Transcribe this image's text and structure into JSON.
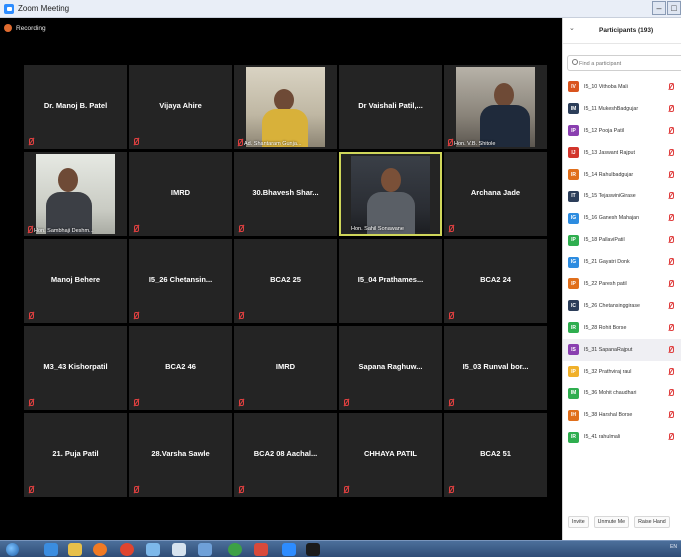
{
  "window": {
    "title": "Zoom Meeting"
  },
  "recording": {
    "label": "Recording"
  },
  "tiles": [
    {
      "name": "Dr. Manoj B. Patel"
    },
    {
      "name": "Vijaya Ahire"
    },
    {
      "name": "",
      "video_label": "Ad. Shantaram Gunja..."
    },
    {
      "name": "Dr Vaishali Patil,..."
    },
    {
      "name": "",
      "video_label": "Hon. V.B. Shitole"
    },
    {
      "name": "",
      "video_label": "Hon. Sambhaji Deshm..."
    },
    {
      "name": "IMRD"
    },
    {
      "name": "30.Bhavesh Shar..."
    },
    {
      "name": "",
      "video_label": "Hon. Sahil Sonawane"
    },
    {
      "name": "Archana Jade"
    },
    {
      "name": "Manoj Behere"
    },
    {
      "name": "I5_26 Chetansin..."
    },
    {
      "name": "BCA2 25"
    },
    {
      "name": "I5_04 Prathames..."
    },
    {
      "name": "BCA2 24"
    },
    {
      "name": "M3_43 Kishorpatil"
    },
    {
      "name": "BCA2 46"
    },
    {
      "name": "IMRD"
    },
    {
      "name": "Sapana Raghuw..."
    },
    {
      "name": "I5_03 Runval bor..."
    },
    {
      "name": "21. Puja Patil"
    },
    {
      "name": "28.Varsha Sawle"
    },
    {
      "name": "BCA2 08 Aachal..."
    },
    {
      "name": "CHHAYA PATIL"
    },
    {
      "name": "BCA2 51"
    }
  ],
  "participants_panel": {
    "title": "Participants (193)",
    "search_placeholder": "Find a participant",
    "items": [
      {
        "initials": "IV",
        "name": "I5_10 Vithoba Mali",
        "color": "#d9541e"
      },
      {
        "initials": "IM",
        "name": "I5_11 MukeshBadgujar",
        "color": "#2c3e5a"
      },
      {
        "initials": "IP",
        "name": "I5_12 Pooja Patil",
        "color": "#8a3fb0"
      },
      {
        "initials": "IJ",
        "name": "I5_13 Jaswant Rajput",
        "color": "#d2352c"
      },
      {
        "initials": "IR",
        "name": "I5_14 Rahulbadgujar",
        "color": "#e06f1c"
      },
      {
        "initials": "IT",
        "name": "I5_15 TejaswiniGirase",
        "color": "#2c3e5a"
      },
      {
        "initials": "IG",
        "name": "I5_16 Ganesh Mahajan",
        "color": "#2d8ce0"
      },
      {
        "initials": "IP",
        "name": "I5_18 PallaviPatil",
        "color": "#2fae4f"
      },
      {
        "initials": "IG",
        "name": "I5_21 Gayatri Donk",
        "color": "#2d8ce0"
      },
      {
        "initials": "IP",
        "name": "I5_22 Paresh patil",
        "color": "#e06f1c"
      },
      {
        "initials": "IC",
        "name": "I5_26 Chetansinggirase",
        "color": "#2c3e5a"
      },
      {
        "initials": "IR",
        "name": "I5_28 Rohit Borse",
        "color": "#2fae4f"
      },
      {
        "initials": "IS",
        "name": "I5_31 SapanaRajput",
        "color": "#8a3fb0"
      },
      {
        "initials": "IP",
        "name": "I5_32 Prathviraj raul",
        "color": "#f0b02a"
      },
      {
        "initials": "IM",
        "name": "I5_36 Mohit chaudhari",
        "color": "#2fae4f"
      },
      {
        "initials": "IH",
        "name": "I5_38 Harshal Borse",
        "color": "#e06f1c"
      },
      {
        "initials": "IR",
        "name": "I5_41 rahulmali",
        "color": "#2fae4f"
      }
    ],
    "highlighted_index": 12,
    "footer": {
      "invite": "Invite",
      "unmute": "Unmute Me",
      "raise_hand": "Raise Hand"
    }
  },
  "colors": {
    "video_bg": "#000000",
    "tile_bg": "#242424",
    "active_border": "#cfd65a",
    "muted_icon": "#e04040",
    "taskbar": "#2f4d76"
  },
  "taskbar": {
    "icons": [
      "start-orb-icon",
      "ie-icon",
      "folder-icon",
      "media-player-icon",
      "chrome-icon",
      "app-icon",
      "notepad-icon",
      "word-icon",
      "circle-app-icon",
      "paint-icon",
      "zoom-icon",
      "terminal-icon"
    ],
    "tray_text": "EN"
  }
}
